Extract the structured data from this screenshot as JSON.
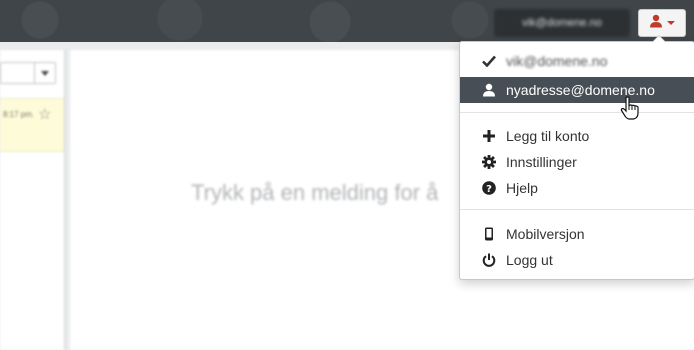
{
  "header": {
    "account_label": "vik@domene.no"
  },
  "inbox": {
    "row_time": "8:17 pm."
  },
  "reading_pane": {
    "placeholder": "Trykk på en melding for å"
  },
  "account_menu": {
    "accounts": [
      {
        "label": "vik@domene.no",
        "icon": "checkmark-icon"
      },
      {
        "label": "nyadresse@domene.no",
        "icon": "user-icon"
      }
    ],
    "actions": [
      {
        "label": "Legg til konto",
        "icon": "plus-icon"
      },
      {
        "label": "Innstillinger",
        "icon": "gear-icon"
      },
      {
        "label": "Hjelp",
        "icon": "help-icon"
      }
    ],
    "footer": [
      {
        "label": "Mobilversjon",
        "icon": "mobile-icon"
      },
      {
        "label": "Logg ut",
        "icon": "power-icon"
      }
    ]
  },
  "colors": {
    "topbar": "#3f4549",
    "menu_highlight": "#474e56",
    "user_icon": "#c0392b"
  }
}
